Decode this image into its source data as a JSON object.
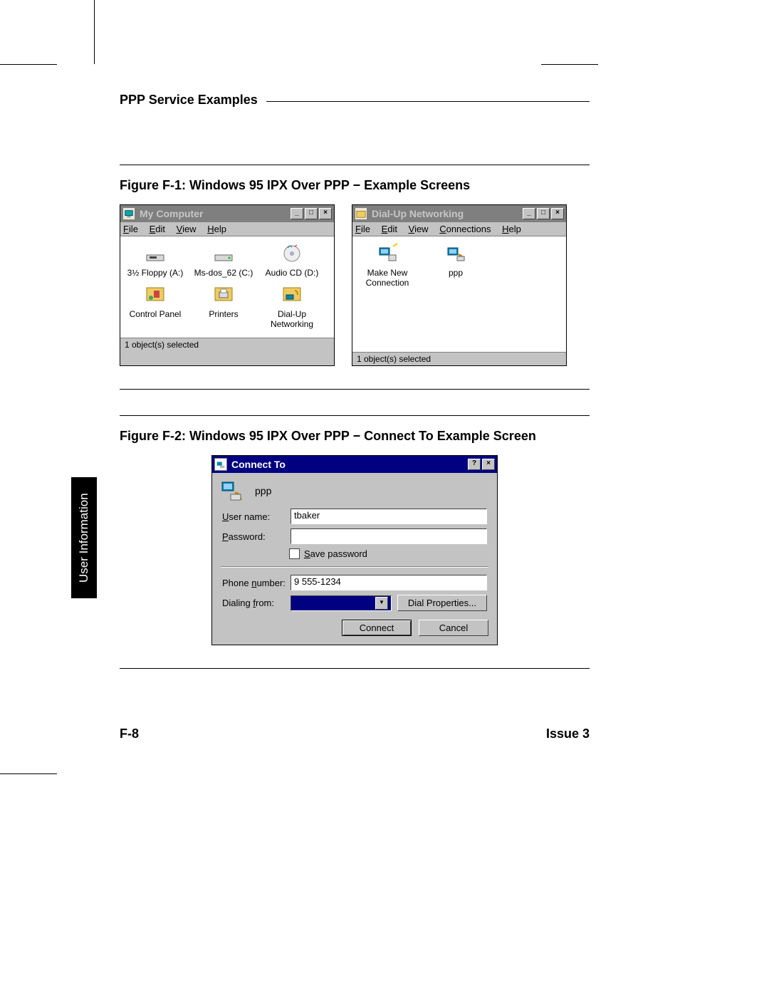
{
  "header": {
    "title": "PPP Service Examples"
  },
  "side_tab": "User Information",
  "footer": {
    "page": "F-8",
    "issue": "Issue 3"
  },
  "figure1": {
    "caption": "Figure F-1:   Windows 95 IPX Over PPP − Example Screens",
    "window_a": {
      "title": "My Computer",
      "menus": [
        "File",
        "Edit",
        "View",
        "Help"
      ],
      "icons": [
        "3½ Floppy (A:)",
        "Ms-dos_62 (C:)",
        "Audio CD (D:)",
        "Control Panel",
        "Printers",
        "Dial-Up Networking"
      ],
      "status": "1 object(s) selected"
    },
    "window_b": {
      "title": "Dial-Up Networking",
      "menus": [
        "File",
        "Edit",
        "View",
        "Connections",
        "Help"
      ],
      "icons": [
        "Make New Connection",
        "ppp"
      ],
      "status": "1 object(s) selected"
    }
  },
  "figure2": {
    "caption": "Figure F-2:   Windows 95 IPX Over PPP − Connect To Example Screen",
    "dialog": {
      "title": "Connect To",
      "connection_name": "ppp",
      "username_label": "User name:",
      "username_value": "tbaker",
      "password_label": "Password:",
      "password_value": "",
      "save_password_label": "Save password",
      "phone_label": "Phone number:",
      "phone_value": "9 555-1234",
      "dialing_from_label": "Dialing from:",
      "dialing_from_value": "",
      "dial_properties_btn": "Dial Properties...",
      "connect_btn": "Connect",
      "cancel_btn": "Cancel"
    }
  }
}
